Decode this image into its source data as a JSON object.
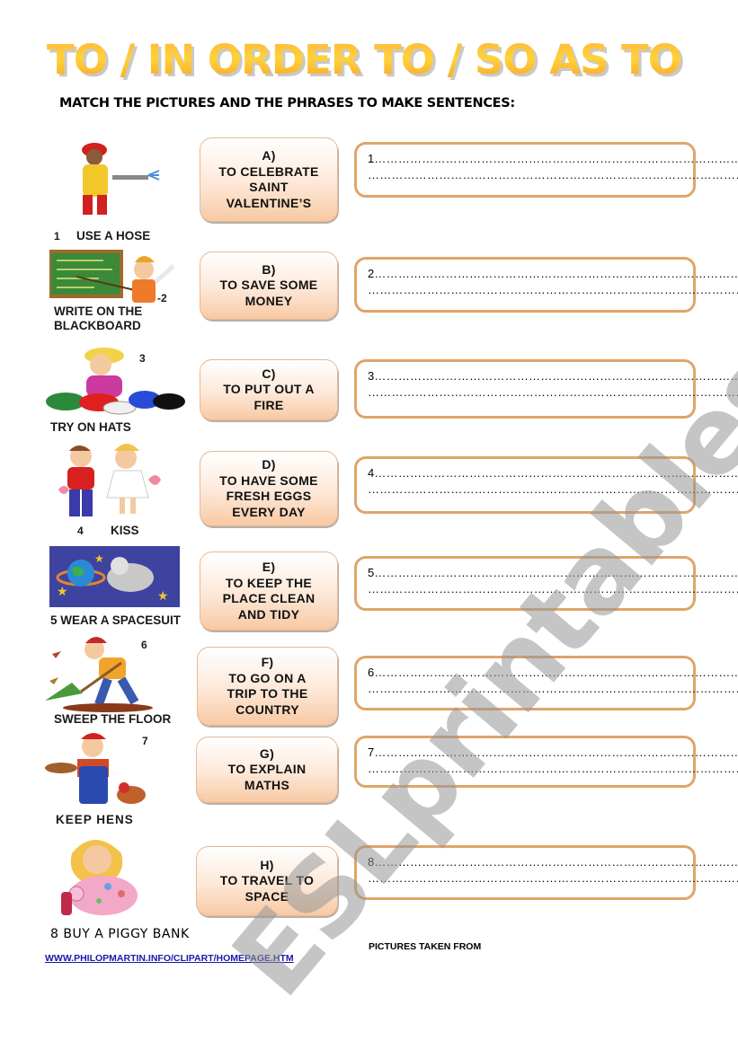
{
  "title": "TO / IN ORDER TO / SO AS TO",
  "instruction": "MATCH THE PICTURES AND THE PHRASES TO MAKE SENTENCES:",
  "watermark": "ESLprintables.com",
  "pictures": [
    {
      "number": "1",
      "label": "USE A HOSE",
      "icon": "firefighter-icon"
    },
    {
      "number": "2",
      "label_line1": "WRITE ON THE",
      "label_line2": "BLACKBOARD",
      "icon": "teacher-blackboard-icon"
    },
    {
      "number": "3",
      "label": "TRY ON HATS",
      "icon": "boy-hats-icon"
    },
    {
      "number": "4",
      "label": "KISS",
      "icon": "kissing-kids-icon"
    },
    {
      "number": "5",
      "label": "5 WEAR A SPACESUIT",
      "icon": "astronaut-icon"
    },
    {
      "number": "6",
      "label": "SWEEP THE FLOOR",
      "icon": "sweeping-boy-icon"
    },
    {
      "number": "7",
      "label": "KEEP HENS",
      "icon": "farmer-hen-icon"
    },
    {
      "number": "8",
      "label": "8 BUY A PIGGY BANK",
      "icon": "piggy-bank-icon"
    }
  ],
  "phrases": [
    {
      "letter": "A)",
      "lines": [
        "TO CELEBRATE",
        "SAINT",
        "VALENTINE’S"
      ]
    },
    {
      "letter": "B)",
      "lines": [
        "TO SAVE SOME",
        "MONEY"
      ]
    },
    {
      "letter": "C)",
      "lines": [
        "TO PUT OUT A",
        "FIRE"
      ]
    },
    {
      "letter": "D)",
      "lines": [
        "TO HAVE SOME",
        "FRESH EGGS",
        "EVERY DAY"
      ]
    },
    {
      "letter": "E)",
      "lines": [
        "TO KEEP THE",
        "PLACE CLEAN",
        "AND TIDY"
      ]
    },
    {
      "letter": "F)",
      "lines": [
        "TO GO ON A",
        "TRIP TO THE",
        "COUNTRY"
      ]
    },
    {
      "letter": "G)",
      "lines": [
        "TO EXPLAIN",
        "MATHS"
      ]
    },
    {
      "letter": "H)",
      "lines": [
        "TO TRAVEL TO",
        "SPACE"
      ]
    }
  ],
  "answers": [
    {
      "line1": "1……………………………………………………………………………………….",
      "line2": "………………………………………………………………………………………"
    },
    {
      "line1": "2……………………………………………………………………………………….",
      "line2": "………………………………………………………………………………………"
    },
    {
      "line1": "3……………………………………………………………………………………",
      "line2": "………………………………………………………………………………………"
    },
    {
      "line1": "4……………………………………………………………………………………….",
      "line2": "………………………………………………………………………………………"
    },
    {
      "line1": "5……………………………………………………………………………………",
      "line2": "………………………………………………………………………………………"
    },
    {
      "line1": "6……………………………………………………………………………………",
      "line2": "………………………………………………………………………………………"
    },
    {
      "line1": "7……………………………………………………………………………………",
      "line2": "………………………………………………………………………………………"
    },
    {
      "line1": "8……………………………………………………………………………………",
      "line2": "………………………………………………………………………………………"
    }
  ],
  "credit": "PICTURES TAKEN FROM",
  "link": "WWW.PHILOPMARTIN.INFO/CLIPART/HOMEPAGE.HTM",
  "colors": {
    "title_orange": "#f7a531",
    "title_yellow": "#ffd23a",
    "answer_border": "#e0a46a",
    "phrase_fill": "#f8c9a3",
    "link_blue": "#1a1aa8"
  }
}
